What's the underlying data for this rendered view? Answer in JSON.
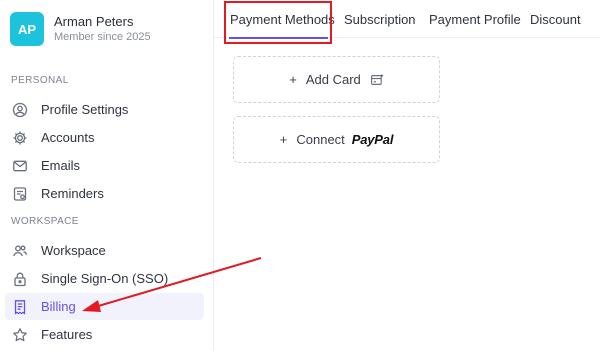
{
  "profile": {
    "initials": "AP",
    "name": "Arman Peters",
    "subtitle": "Member since 2025"
  },
  "sidebar": {
    "personal_label": "PERSONAL",
    "workspace_label": "WORKSPACE",
    "personal_items": [
      {
        "label": "Profile Settings",
        "icon": "user-circle-icon"
      },
      {
        "label": "Accounts",
        "icon": "settings-icon"
      },
      {
        "label": "Emails",
        "icon": "mail-icon"
      },
      {
        "label": "Reminders",
        "icon": "reminder-icon"
      }
    ],
    "workspace_items": [
      {
        "label": "Workspace",
        "icon": "users-icon"
      },
      {
        "label": "Single Sign-On (SSO)",
        "icon": "lock-icon"
      },
      {
        "label": "Billing",
        "icon": "receipt-icon",
        "active": true
      },
      {
        "label": "Features",
        "icon": "star-icon"
      }
    ]
  },
  "tabs": [
    {
      "label": "Payment Methods",
      "active": true
    },
    {
      "label": "Subscription"
    },
    {
      "label": "Payment Profile"
    },
    {
      "label": "Discount"
    }
  ],
  "main": {
    "add_card": {
      "plus": "+",
      "label": "Add Card",
      "icon": "card-icon"
    },
    "connect_paypal": {
      "plus": "+",
      "label": "Connect",
      "brand": "PayPal"
    }
  },
  "colors": {
    "accent": "#6a4fe6",
    "avatar": "#1dc3dc",
    "annotation": "#e21a22"
  }
}
